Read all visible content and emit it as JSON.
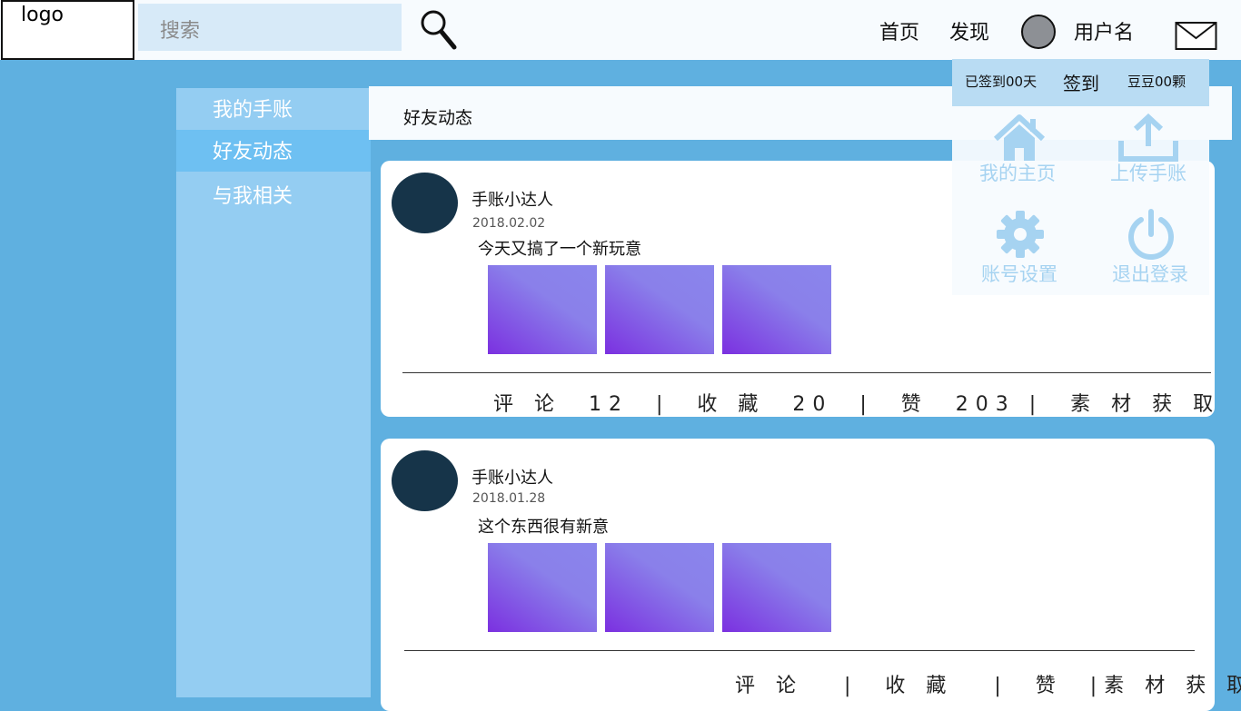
{
  "header": {
    "logo": "logo",
    "search_placeholder": "搜索",
    "nav_home": "首页",
    "nav_discover": "发现",
    "username": "用户名"
  },
  "sidebar": {
    "items": [
      {
        "label": "我的手账"
      },
      {
        "label": "好友动态"
      },
      {
        "label": "与我相关"
      }
    ]
  },
  "feed": {
    "header_title": "好友动态",
    "posts": [
      {
        "author": "手账小达人",
        "date": "2018.02.02",
        "text": "今天又搞了一个新玩意",
        "comment": "评 论  12  ",
        "favorite": "收 藏  20  ",
        "like": "赞  203 ",
        "material": "素 材 获 取"
      },
      {
        "author": "手账小达人",
        "date": "2018.01.28",
        "text": "这个东西很有新意",
        "comment": "评 论   ",
        "favorite": "收 藏   ",
        "like": "赞  ",
        "material": "素 材 获 取"
      }
    ]
  },
  "dropdown": {
    "checkin_days": "已签到00天",
    "checkin_button": "签到",
    "beans": "豆豆00颗",
    "items": [
      {
        "label": "我的主页",
        "icon": "home-icon"
      },
      {
        "label": "上传手账",
        "icon": "upload-icon"
      },
      {
        "label": "账号设置",
        "icon": "gear-icon"
      },
      {
        "label": "退出登录",
        "icon": "power-icon"
      }
    ]
  },
  "colors": {
    "background": "#5fb0e0",
    "sidebar": "#94cdf2",
    "sidebar_active": "#6ec0f2",
    "avatar": "#163449",
    "dropdown_icon": "#a6d3f1"
  }
}
